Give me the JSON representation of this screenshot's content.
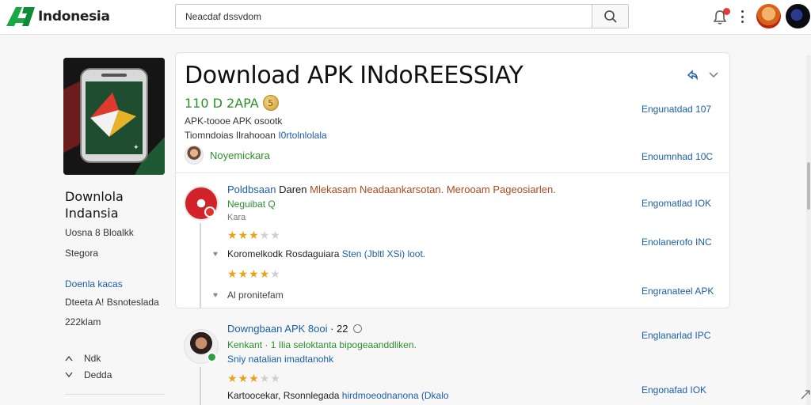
{
  "header": {
    "logo_text": "Indonesia",
    "search_value": "Neacdaf dssvdom"
  },
  "sidebar": {
    "title_line1": "Downlola",
    "title_line2": "Indansia",
    "line1": "Uosna 8 Bloalkk",
    "line2": "Stegora",
    "link": "Doenla kacas",
    "line3": "Dteeta A! Bsnoteslada",
    "line4": "222klam",
    "row1_label": "Ndk",
    "row2_label": "Dedda"
  },
  "card": {
    "title": "Download APK  INdoREESSIAY",
    "rating_text": "110 D 2APA",
    "coin_label": "5",
    "meta1": "APK-toooe APK osootk",
    "meta2_plain": "Tiomndoias Ilrahooan",
    "meta2_blue": "I0rtolnlolala",
    "developer": "Noyemickara"
  },
  "download_links": [
    "Engunatdad 107",
    "Enoumnhad 10C",
    "Engomatlad IOK",
    "Enolanerofo INC",
    "Engranateel APK",
    "Englanarlad IPC",
    "Engonafad IOK"
  ],
  "reviews": [
    {
      "name": "Poldbsaan",
      "title_dark": "Daren",
      "title_orange": "Mlekasam Neadaankarsotan. Merooam Pageosiarlen.",
      "sub": "Neguibat  Q",
      "small": "Kara",
      "stars": 3,
      "text_plain": "Koromelkodk Rosdaguiara",
      "text_blue": "Sten (Jbltl XSi) loot.",
      "stars2": 4,
      "text2": "Al pronitefam"
    },
    {
      "name": "Downgbaan APK 8ooi",
      "suffix": "· 22",
      "sub": "Kenkant  · 1 Ilia seloktanta bipogeaanddliken.",
      "sub_blue": "Sniy natalian imadtanohk",
      "stars": 3,
      "text_plain": "Kartoocekar, Rsonnlegada",
      "text_blue": "hirdmoeodnanona (Dkalo"
    }
  ],
  "colors": {
    "accent_green": "#2d8f2d",
    "link_blue": "#1b5fa8",
    "star": "#e8a317",
    "logo_green": "#16a34a"
  }
}
